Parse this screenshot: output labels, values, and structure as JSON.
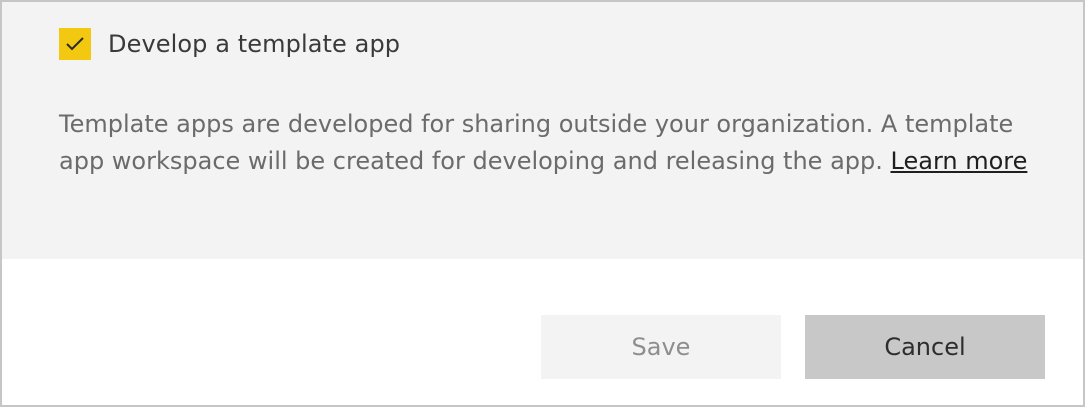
{
  "template_option": {
    "checkbox_label": "Develop a template app",
    "checked": true,
    "checkbox_color": "#f2c811"
  },
  "description": {
    "text": "Template apps are developed for sharing outside your organization. A template app workspace will be created for developing and releasing the app.  ",
    "link_text": "Learn more"
  },
  "actions": {
    "save_label": "Save",
    "cancel_label": "Cancel"
  }
}
